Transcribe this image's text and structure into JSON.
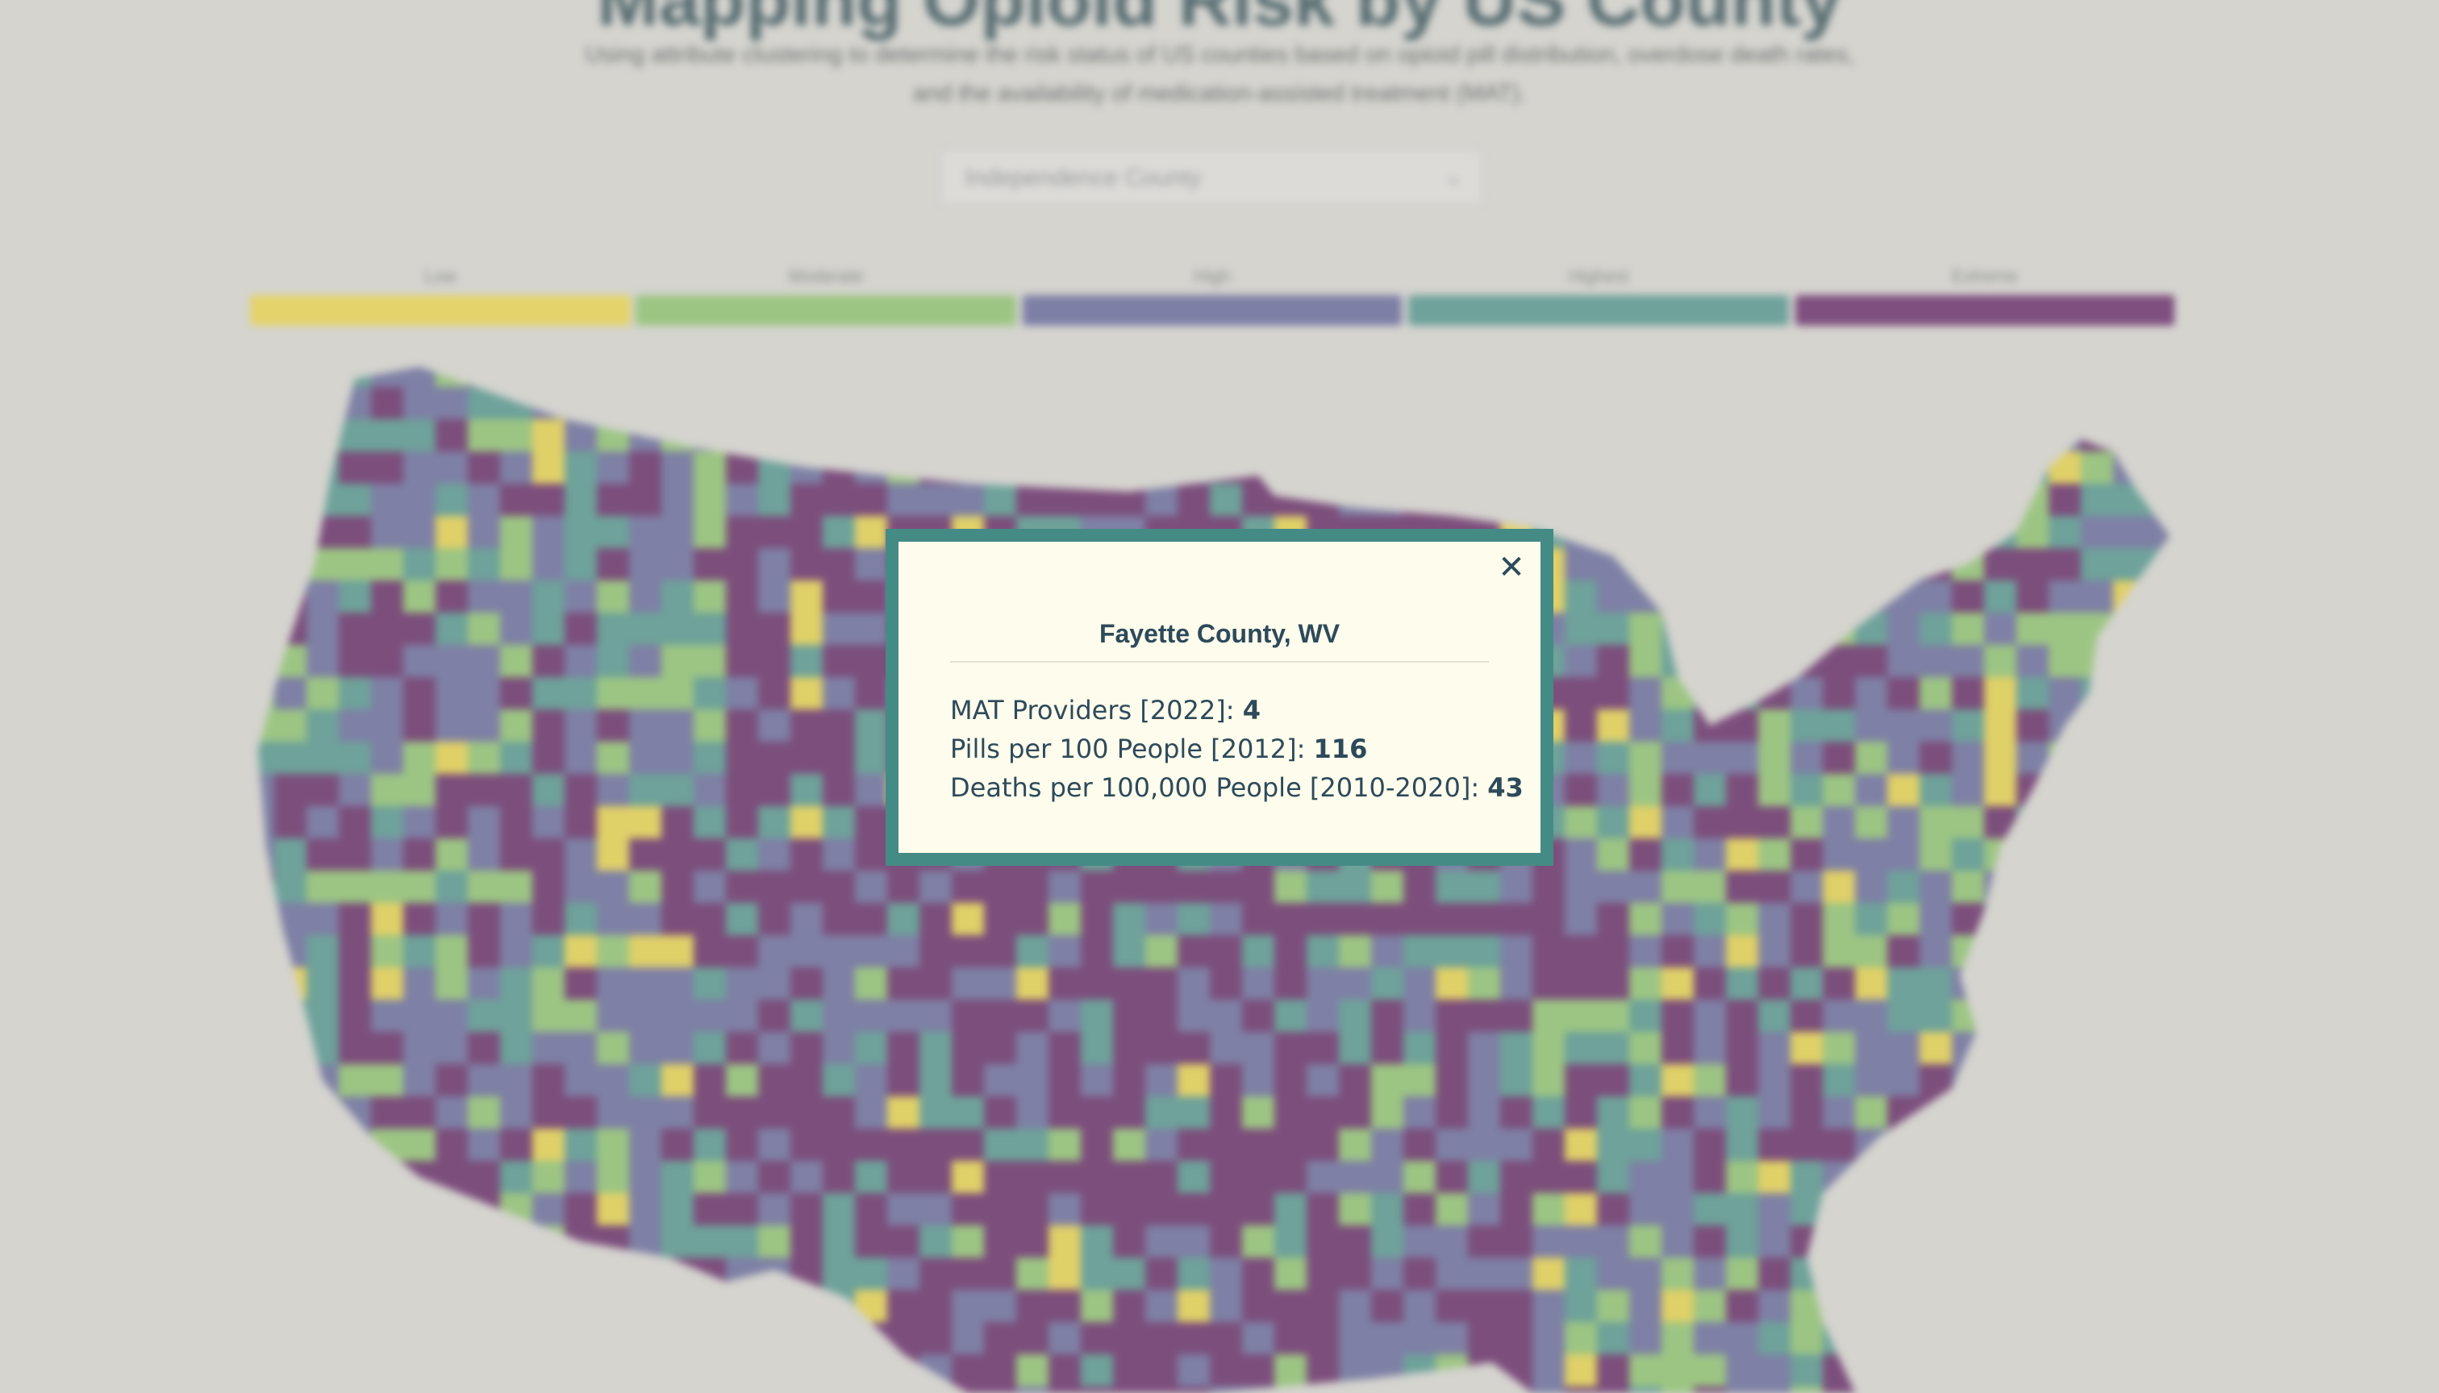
{
  "page": {
    "heading": "Mapping Opioid Risk by US County",
    "subtitle": "Using attribute clustering to determine the risk status of US counties based on opioid pill distribution, overdose death rates, and the availability of medication-assisted treatment (MAT).",
    "county_select": {
      "value": "Independence County",
      "chevron_icon": "chevron-down-icon"
    }
  },
  "legend": {
    "items": [
      {
        "label": "Low",
        "color": "#e4d36a"
      },
      {
        "label": "Moderate",
        "color": "#9cc583"
      },
      {
        "label": "High",
        "color": "#7e7fa6"
      },
      {
        "label": "Highest",
        "color": "#6fa29b"
      },
      {
        "label": "Extreme",
        "color": "#7e4f7f"
      }
    ]
  },
  "map": {
    "palette": {
      "low": "#e0d068",
      "moderate": "#9cc583",
      "high": "#7e80a5",
      "highest": "#6ea29a",
      "extreme": "#7c4e7c"
    }
  },
  "modal": {
    "close_icon": "close-icon",
    "close_glyph": "✕",
    "title": "Fayette County, WV",
    "rows": [
      {
        "label": "MAT Providers [2022]: ",
        "value": "4"
      },
      {
        "label": "Pills per 100 People [2012]: ",
        "value": "116"
      },
      {
        "label": "Deaths per 100,000 People [2010-2020]: ",
        "value": "43"
      }
    ],
    "colors": {
      "border": "#458b85",
      "background": "#fefcec",
      "text": "#2d4a5a"
    }
  }
}
